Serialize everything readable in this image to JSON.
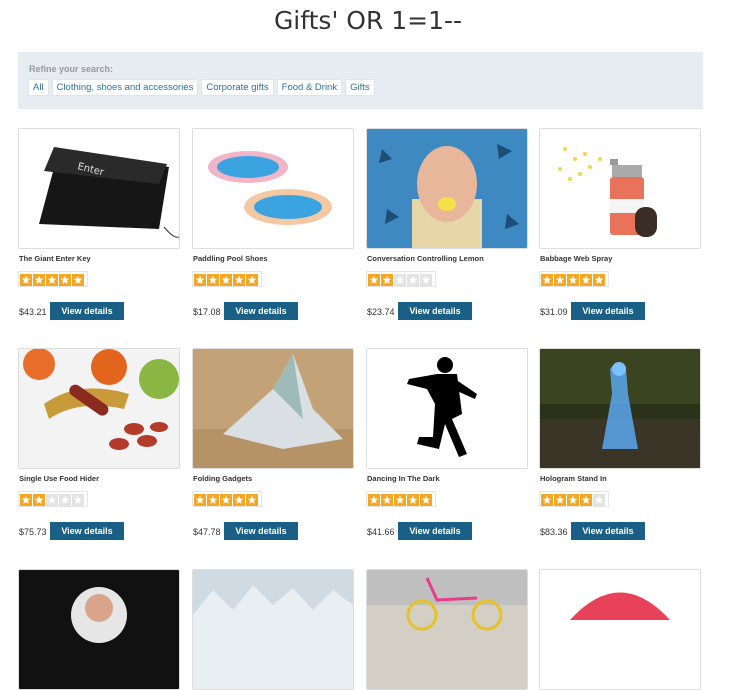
{
  "page": {
    "title": "Gifts' OR 1=1--"
  },
  "refine": {
    "label": "Refine your search:",
    "filters": [
      "All",
      "Clothing, shoes and accessories",
      "Corporate gifts",
      "Food & Drink",
      "Gifts"
    ]
  },
  "colors": {
    "button": "#1a5f85",
    "star_on": "#f5a623",
    "star_off": "#e3e3e3",
    "filter_text": "#2a71a8"
  },
  "products": [
    {
      "name": "The Giant Enter Key",
      "rating": 5,
      "price": "$43.21",
      "button": "View details",
      "image": "giant-enter-key-image"
    },
    {
      "name": "Paddling Pool Shoes",
      "rating": 5,
      "price": "$17.08",
      "button": "View details",
      "image": "paddling-pool-image"
    },
    {
      "name": "Conversation Controlling Lemon",
      "rating": 2,
      "price": "$23.74",
      "button": "View details",
      "image": "lemon-face-image"
    },
    {
      "name": "Babbage Web Spray",
      "rating": 5,
      "price": "$31.09",
      "button": "View details",
      "image": "spray-can-image"
    },
    {
      "name": "Single Use Food Hider",
      "rating": 2,
      "price": "$75.73",
      "button": "View details",
      "image": "food-platter-image"
    },
    {
      "name": "Folding Gadgets",
      "rating": 5,
      "price": "$47.78",
      "button": "View details",
      "image": "folded-banknote-image"
    },
    {
      "name": "Dancing In The Dark",
      "rating": 5,
      "price": "$41.66",
      "button": "View details",
      "image": "dancer-silhouette-image"
    },
    {
      "name": "Hologram Stand In",
      "rating": 4,
      "price": "$83.36",
      "button": "View details",
      "image": "hologram-woman-image"
    },
    {
      "name": "",
      "rating": 0,
      "price": "",
      "button": "",
      "image": "santa-image"
    },
    {
      "name": "",
      "rating": 0,
      "price": "",
      "button": "",
      "image": "snowy-forest-image"
    },
    {
      "name": "",
      "rating": 0,
      "price": "",
      "button": "",
      "image": "bicycle-image"
    },
    {
      "name": "",
      "rating": 0,
      "price": "",
      "button": "",
      "image": "umbrella-image"
    }
  ]
}
